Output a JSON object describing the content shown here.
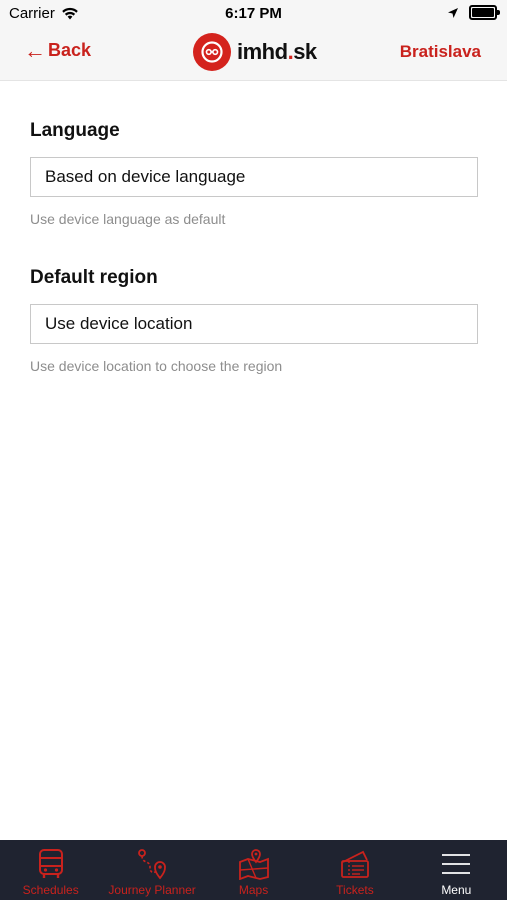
{
  "status": {
    "carrier": "Carrier",
    "time": "6:17 PM"
  },
  "nav": {
    "back_label": "Back",
    "logo_text_main": "imhd",
    "logo_text_dot": ".",
    "logo_text_tld": "sk",
    "region_label": "Bratislava"
  },
  "settings": {
    "language": {
      "title": "Language",
      "value": "Based on device language",
      "helper": "Use device language as default"
    },
    "region": {
      "title": "Default region",
      "value": "Use device location",
      "helper": "Use device location to choose the region"
    }
  },
  "tabs": [
    {
      "label": "Schedules",
      "icon": "bus-icon"
    },
    {
      "label": "Journey Planner",
      "icon": "route-pin-icon"
    },
    {
      "label": "Maps",
      "icon": "map-icon"
    },
    {
      "label": "Tickets",
      "icon": "ticket-icon"
    },
    {
      "label": "Menu",
      "icon": "hamburger-menu-icon"
    }
  ],
  "colors": {
    "accent": "#c9221d",
    "tabbar_bg": "#1f2330",
    "header_bg": "#f6f6f6"
  }
}
